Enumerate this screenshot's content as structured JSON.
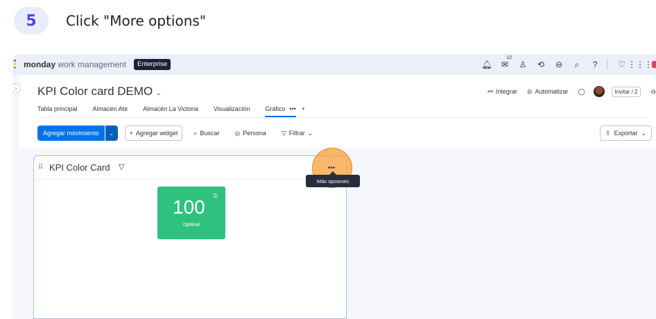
{
  "step": {
    "number": "5",
    "instruction": "Click \"More options\""
  },
  "topbar": {
    "brand_bold": "monday",
    "brand_rest": " work management",
    "plan_badge": "Enterprise",
    "notifications_count": "12"
  },
  "board": {
    "title": "KPI Color card DEMO",
    "tabs": [
      {
        "label": "Tabla principal"
      },
      {
        "label": "Almacén Ate"
      },
      {
        "label": "Almacén La Victoria"
      },
      {
        "label": "Visualización"
      },
      {
        "label": "Gráfico"
      }
    ],
    "tab_more": "•••",
    "tab_add": "+",
    "integrate_label": "Integrar",
    "automate_label": "Automatizar",
    "invite_label": "Invitar / 2"
  },
  "toolbar": {
    "primary_label": "Agregar movimiento",
    "add_widget_label": "Agregar widget",
    "search_label": "Buscar",
    "person_label": "Persona",
    "filter_label": "Filtrar",
    "export_label": "Exportar"
  },
  "widget": {
    "title": "KPI Color Card",
    "more_glyph": "•••",
    "tooltip": "Más opciones",
    "kpi": {
      "value": "100",
      "label": "Optimal",
      "color": "#2ec27e"
    }
  },
  "colors": {
    "accent": "#0073ea",
    "highlight": "#f7a23a",
    "kpi_green": "#2ec27e"
  }
}
